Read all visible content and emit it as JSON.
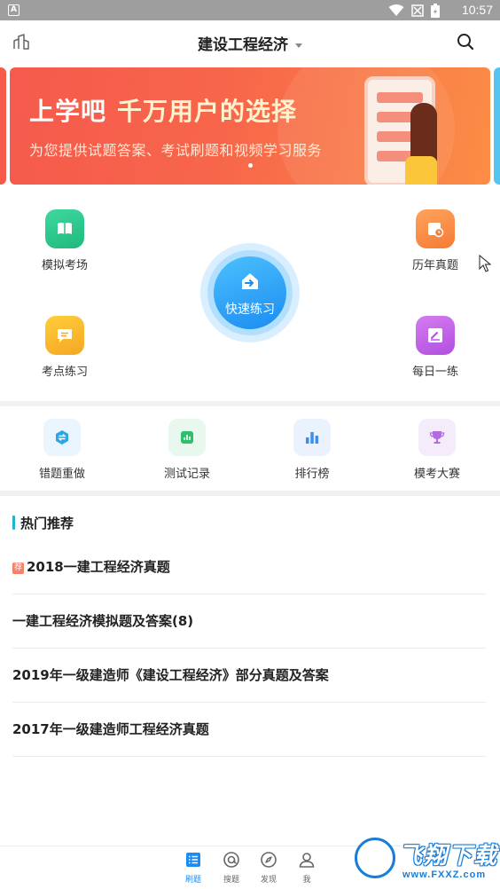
{
  "status_bar": {
    "badge": "A",
    "time": "10:57"
  },
  "app_bar": {
    "title": "建设工程经济"
  },
  "banner": {
    "headline": "上学吧",
    "slogan": "千万用户的选择",
    "subtitle": "为您提供试题答案、考试刷题和视频学习服务",
    "accent_color": "#f55a4d"
  },
  "main_grid": {
    "mock_exam": "模拟考场",
    "past_exams": "历年真题",
    "key_points": "考点练习",
    "daily_practice": "每日一练",
    "quick_practice": "快速练习"
  },
  "tools": {
    "redo_wrong": "错题重做",
    "test_records": "测试记录",
    "ranking": "排行榜",
    "mock_contest": "模考大赛"
  },
  "hot": {
    "title": "热门推荐",
    "tag": "荐",
    "items": [
      "2018一建工程经济真题",
      "一建工程经济模拟题及答案(8)",
      "2019年一级建造师《建设工程经济》部分真题及答案",
      "2017年一级建造师工程经济真题"
    ]
  },
  "bottom_nav": {
    "items": [
      "刷题",
      "搜题",
      "发现",
      "我"
    ],
    "active_color": "#1b8cf0"
  },
  "watermark": {
    "name": "飞翔下载",
    "url": "www.FXXZ.com"
  }
}
